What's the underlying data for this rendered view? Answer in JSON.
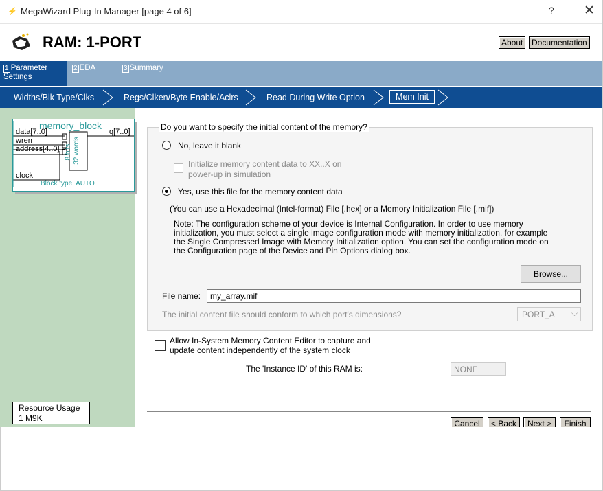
{
  "window": {
    "title": "MegaWizard Plug-In Manager [page 4 of 6]",
    "help_glyph": "?",
    "close_glyph": "✕"
  },
  "header": {
    "title": "RAM: 1-PORT",
    "about_label": "About",
    "doc_label": "Documentation"
  },
  "steps": [
    {
      "num": "1",
      "label": "Parameter Settings"
    },
    {
      "num": "2",
      "label": "EDA"
    },
    {
      "num": "3",
      "label": "Summary"
    }
  ],
  "crumbs": [
    "Widths/Blk Type/Clks",
    "Regs/Clken/Byte Enable/Aclrs",
    "Read During Write Option",
    "Mem Init"
  ],
  "symbol": {
    "name": "memory_block",
    "ports_in": [
      "data[7..0]",
      "wren",
      "address[4..0]",
      "clock"
    ],
    "port_out": "q[7..0]",
    "inner_bits": "8 bits",
    "inner_words": "32 words",
    "block_type": "Block type: AUTO"
  },
  "resource": {
    "label": "Resource Usage",
    "value": "1 M9K"
  },
  "mem_init": {
    "question": "Do you want to specify the initial content of the memory?",
    "option_blank": "No, leave it blank",
    "init_xx_line1": "Initialize memory content data to XX..X on",
    "init_xx_line2": "power-up in simulation",
    "option_file": "Yes, use this file for the memory content data",
    "hint": "(You can use a Hexadecimal (Intel-format) File [.hex] or a Memory Initialization File [.mif])",
    "note_lines": [
      "Note: The configuration scheme of your device is Internal Configuration. In order to use memory",
      "initialization, you must select a single image configuration mode with memory initialization, for example",
      "the Single Compressed Image with Memory Initialization option. You can set the configuration mode on",
      "the Configuration page of the Device and Pin Options dialog box."
    ],
    "browse_label": "Browse...",
    "file_name_label": "File name:",
    "file_name_value": "my_array.mif",
    "port_question": "The initial content file should conform to which port's dimensions?",
    "port_value": "PORT_A",
    "selected": "file"
  },
  "editor": {
    "line1": "Allow In-System Memory Content Editor to capture and",
    "line2": "update content independently of the system clock",
    "instance_label": "The 'Instance ID' of this RAM is:",
    "instance_value": "NONE"
  },
  "nav": {
    "cancel": "Cancel",
    "back": "< Back",
    "next": "Next >",
    "finish": "Finish"
  }
}
